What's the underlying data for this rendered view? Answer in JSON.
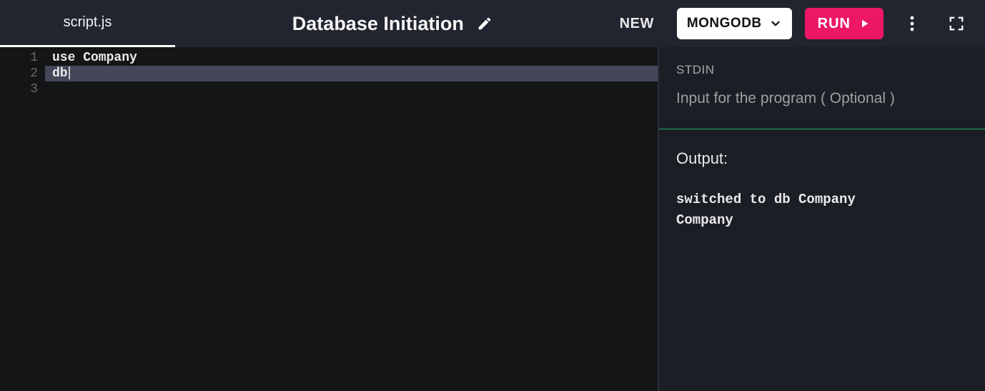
{
  "header": {
    "tab_label": "script.js",
    "title": "Database Initiation",
    "new_label": "NEW",
    "language_label": "MONGODB",
    "run_label": "RUN"
  },
  "editor": {
    "lines": [
      "use Company",
      "db",
      ""
    ],
    "line_numbers": [
      "1",
      "2",
      "3"
    ],
    "active_line_index": 1
  },
  "stdin": {
    "label": "STDIN",
    "placeholder": "Input for the program ( Optional )",
    "value": ""
  },
  "output": {
    "title": "Output:",
    "body": "switched to db Company\nCompany"
  }
}
